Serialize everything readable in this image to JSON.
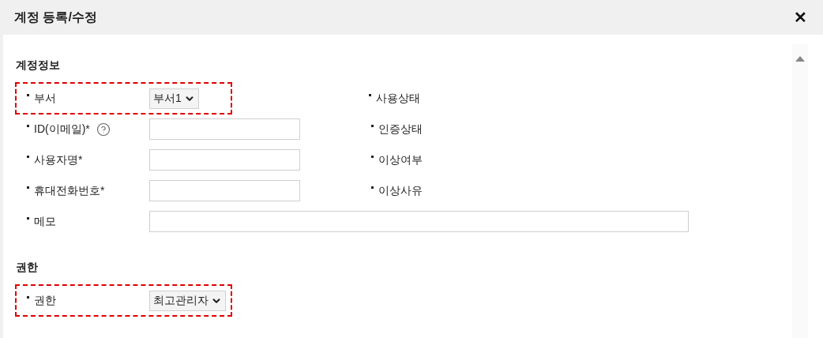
{
  "dialog": {
    "title": "계정 등록/수정",
    "close": "✕"
  },
  "sections": [
    {
      "title": "계정정보",
      "rows": [
        {
          "kind": "select",
          "label": "부서",
          "value": "부서1",
          "highlighted": true,
          "help": false
        },
        {
          "kind": "input",
          "label": "ID(이메일)*",
          "highlighted": false,
          "help": true
        },
        {
          "kind": "input",
          "label": "사용자명*",
          "highlighted": false,
          "help": false
        },
        {
          "kind": "input",
          "label": "휴대전화번호*",
          "highlighted": false,
          "help": false
        },
        {
          "kind": "wide_input",
          "label": "메모",
          "highlighted": false,
          "help": false
        }
      ],
      "side_labels": [
        "사용상태",
        "인증상태",
        "이상여부",
        "이상사유"
      ]
    },
    {
      "title": "권한",
      "rows": [
        {
          "kind": "select",
          "label": "권한",
          "value": "최고관리자",
          "highlighted": true,
          "help": false
        }
      ]
    }
  ]
}
